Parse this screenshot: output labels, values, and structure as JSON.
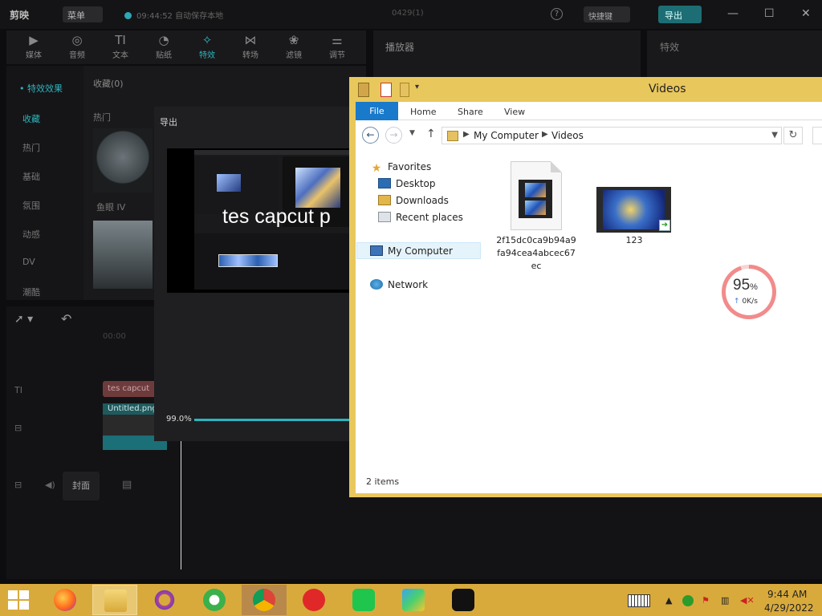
{
  "capcut": {
    "logo": "剪映",
    "menu": "菜单",
    "autosave": "09:44:52 自动保存本地",
    "project_name": "0429(1)",
    "help_icon": "?",
    "shortcut_label": "快捷键",
    "export_label": "导出",
    "toolbar": [
      {
        "label": "媒体",
        "glyph": "▶"
      },
      {
        "label": "音频",
        "glyph": "◎"
      },
      {
        "label": "文本",
        "glyph": "TI"
      },
      {
        "label": "贴纸",
        "glyph": "◔"
      },
      {
        "label": "特效",
        "glyph": "✧"
      },
      {
        "label": "转场",
        "glyph": "⋈"
      },
      {
        "label": "滤镜",
        "glyph": "❀"
      },
      {
        "label": "调节",
        "glyph": "⚌"
      }
    ],
    "effects_header": "• 特效效果",
    "categories": [
      "收藏",
      "热门",
      "基础",
      "氛围",
      "动感",
      "DV",
      "潮酷"
    ],
    "favorites_label": "收藏(0)",
    "hot_label": "热门",
    "effect_name": "鱼眼 IV",
    "player_label": "播放器",
    "effect_panel_label": "特效",
    "timecode": "00:00",
    "text_clip": "tes capcut",
    "video_clip": "Untitled.png",
    "cover_label": "封面"
  },
  "export_dialog": {
    "title": "导出",
    "overlay_text": "tes capcut p",
    "progress_text": "99.0%",
    "progress_value": 0.99
  },
  "explorer": {
    "title": "Videos",
    "ribbon_tabs": [
      "File",
      "Home",
      "Share",
      "View"
    ],
    "breadcrumb": [
      "My Computer",
      "Videos"
    ],
    "nav": {
      "favorites": "Favorites",
      "desktop": "Desktop",
      "downloads": "Downloads",
      "recent": "Recent places",
      "my_computer": "My Computer",
      "network": "Network"
    },
    "files": [
      {
        "name": "2f15dc0ca9b94a9fa94cea4abcec67ec",
        "name_lines": [
          "2f15dc0ca9b94a9",
          "fa94cea4abcec67",
          "ec"
        ],
        "icon": "video-file-icon"
      },
      {
        "name": "123",
        "icon": "video-thumbnail-icon"
      }
    ],
    "status": "2 items"
  },
  "speed_widget": {
    "percent": "95",
    "percent_unit": "%",
    "percent_value": 95,
    "speed": "0K/s"
  },
  "taskbar": {
    "apps": [
      "firefox-icon",
      "file-explorer-icon",
      "app-o-icon",
      "refresh-app-icon",
      "chrome-icon",
      "netease-music-icon",
      "iqiyi-icon",
      "player-icon",
      "capcut-icon"
    ],
    "time": "9:44 AM",
    "date": "4/29/2022",
    "colors": {
      "taskbar": "#d8aa3c",
      "accent": "#2fb3bd"
    }
  }
}
